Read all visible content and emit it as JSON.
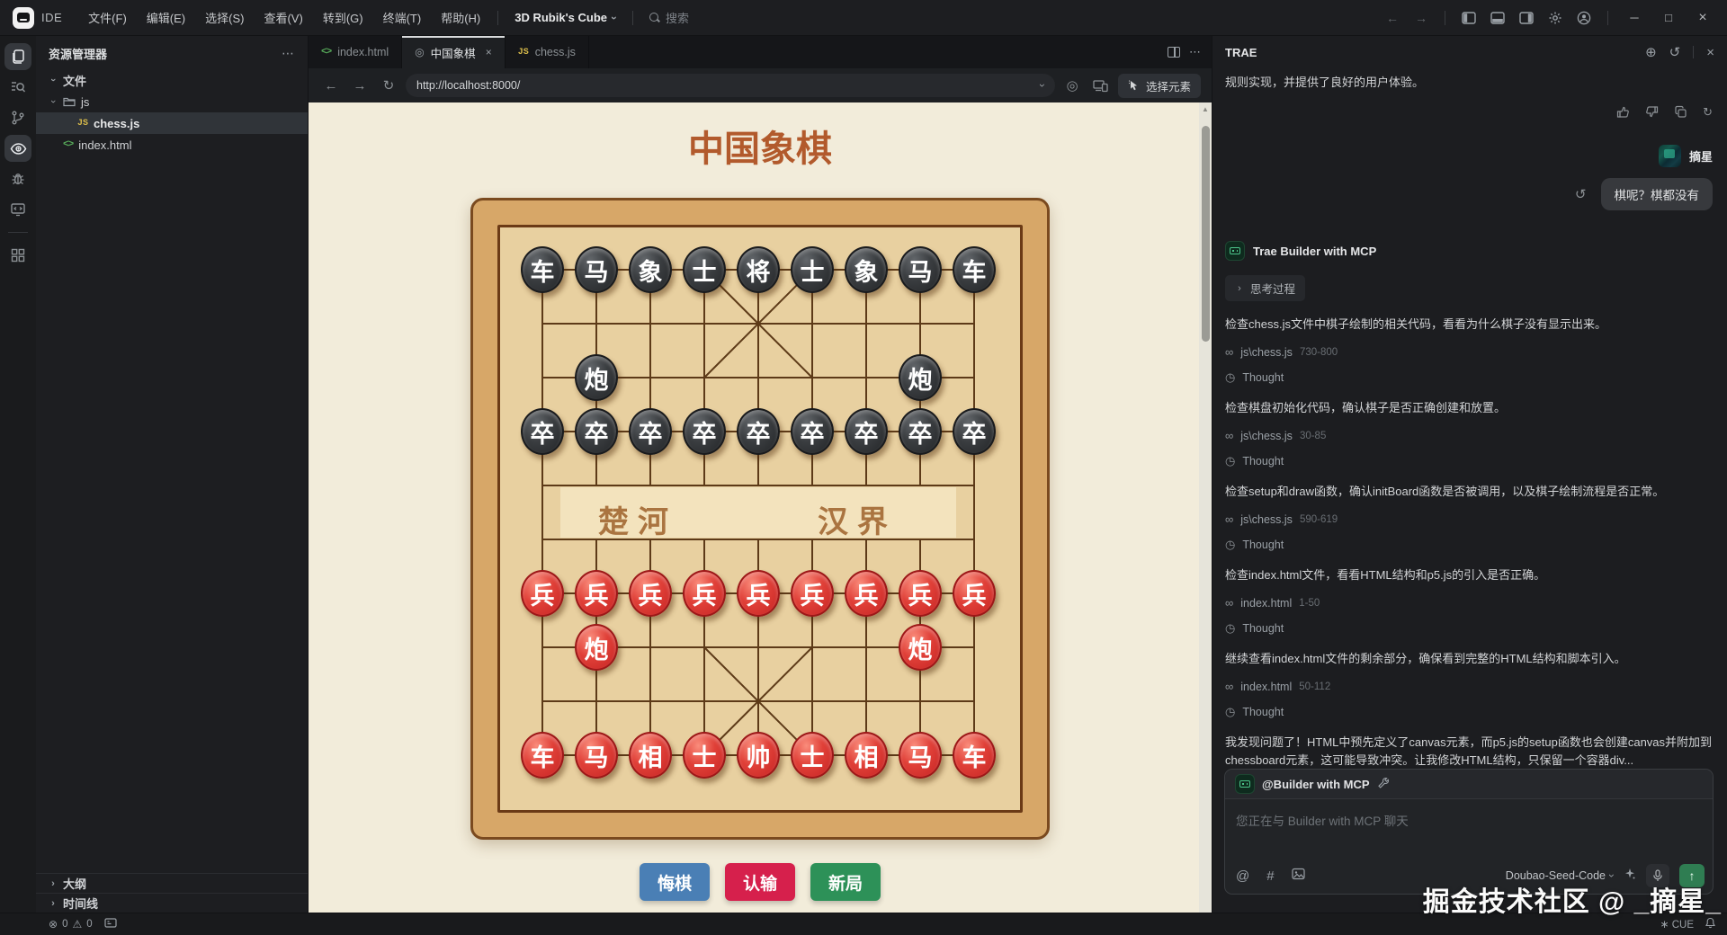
{
  "titlebar": {
    "logo": "IDE",
    "menus": [
      "文件(F)",
      "编辑(E)",
      "选择(S)",
      "查看(V)",
      "转到(G)",
      "终端(T)",
      "帮助(H)"
    ],
    "project": "3D Rubik's Cube",
    "search_placeholder": "搜索"
  },
  "explorer": {
    "title": "资源管理器",
    "more": "⋯",
    "root_label": "文件",
    "folder_label": "js",
    "file_js": "chess.js",
    "file_html": "index.html",
    "outline_label": "大纲",
    "timeline_label": "时间线"
  },
  "tabs": [
    {
      "label": "index.html",
      "icon": "html",
      "active": false,
      "closable": false
    },
    {
      "label": "中国象棋",
      "icon": "preview",
      "active": true,
      "closable": true
    },
    {
      "label": "chess.js",
      "icon": "js",
      "active": false,
      "closable": false
    }
  ],
  "browser": {
    "url": "http://localhost:8000/",
    "select_element_label": "选择元素"
  },
  "preview": {
    "page_title": "中国象棋",
    "page_bg": "#f2ecda",
    "title_color": "#b25a2c",
    "river_left": "楚河",
    "river_right": "汉界",
    "buttons": [
      {
        "label": "悔棋",
        "color": "#4a7fb5"
      },
      {
        "label": "认输",
        "color": "#d6204c"
      },
      {
        "label": "新局",
        "color": "#2d9158"
      }
    ],
    "board": {
      "cols": 9,
      "rows": 10,
      "cell": 60,
      "frame_color": "#d7a768",
      "field_color": "#e8d0a0",
      "line_color": "#5d3a18",
      "black_piece_color": "#2b2d30",
      "red_piece_color": "#d42c2c",
      "layout": [
        {
          "row": 0,
          "side": "black",
          "cols": [
            0,
            1,
            2,
            3,
            4,
            5,
            6,
            7,
            8
          ],
          "chars": [
            "车",
            "马",
            "象",
            "士",
            "将",
            "士",
            "象",
            "马",
            "车"
          ]
        },
        {
          "row": 2,
          "side": "black",
          "cols": [
            1,
            7
          ],
          "chars": [
            "炮",
            "炮"
          ]
        },
        {
          "row": 3,
          "side": "black",
          "cols": [
            0,
            1,
            2,
            3,
            4,
            5,
            6,
            7,
            8
          ],
          "chars": [
            "卒",
            "卒",
            "卒",
            "卒",
            "卒",
            "卒",
            "卒",
            "卒",
            "卒"
          ]
        },
        {
          "row": 6,
          "side": "red",
          "cols": [
            0,
            1,
            2,
            3,
            4,
            5,
            6,
            7,
            8
          ],
          "chars": [
            "兵",
            "兵",
            "兵",
            "兵",
            "兵",
            "兵",
            "兵",
            "兵",
            "兵"
          ]
        },
        {
          "row": 7,
          "side": "red",
          "cols": [
            1,
            7
          ],
          "chars": [
            "炮",
            "炮"
          ]
        },
        {
          "row": 9,
          "side": "red",
          "cols": [
            0,
            1,
            2,
            3,
            4,
            5,
            6,
            7,
            8
          ],
          "chars": [
            "车",
            "马",
            "相",
            "士",
            "帅",
            "士",
            "相",
            "马",
            "车"
          ]
        }
      ]
    }
  },
  "chat": {
    "title": "TRAE",
    "previous_tail": "规则实现，并提供了良好的用户体验。",
    "user_name": "摘星",
    "user_message": "棋呢？棋都没有",
    "assistant_name": "Trae Builder with MCP",
    "thinking_label": "思考过程",
    "items": [
      {
        "type": "text",
        "text": "检查chess.js文件中棋子绘制的相关代码，看看为什么棋子没有显示出来。"
      },
      {
        "type": "ref",
        "file": "js\\chess.js",
        "range": "730-800"
      },
      {
        "type": "thought",
        "label": "Thought"
      },
      {
        "type": "text",
        "text": "检查棋盘初始化代码，确认棋子是否正确创建和放置。"
      },
      {
        "type": "ref",
        "file": "js\\chess.js",
        "range": "30-85"
      },
      {
        "type": "thought",
        "label": "Thought"
      },
      {
        "type": "text",
        "text": "检查setup和draw函数，确认initBoard函数是否被调用，以及棋子绘制流程是否正常。"
      },
      {
        "type": "ref",
        "file": "js\\chess.js",
        "range": "590-619"
      },
      {
        "type": "thought",
        "label": "Thought"
      },
      {
        "type": "text",
        "text": "检查index.html文件，看看HTML结构和p5.js的引入是否正确。"
      },
      {
        "type": "ref",
        "file": "index.html",
        "range": "1-50"
      },
      {
        "type": "thought",
        "label": "Thought"
      },
      {
        "type": "text",
        "text": "继续查看index.html文件的剩余部分，确保看到完整的HTML结构和脚本引入。"
      },
      {
        "type": "ref",
        "file": "index.html",
        "range": "50-112"
      },
      {
        "type": "thought",
        "label": "Thought"
      },
      {
        "type": "text",
        "text": "我发现问题了！HTML中预先定义了canvas元素，而p5.js的setup函数也会创建canvas并附加到chessboard元素，这可能导致冲突。让我修改HTML结构，只保留一个容器div..."
      }
    ],
    "input": {
      "agent": "@Builder with MCP",
      "placeholder": "您正在与 Builder with MCP 聊天",
      "model": "Doubao-Seed-Code"
    },
    "watermark": "掘金技术社区 @ _摘星_"
  },
  "statusbar": {
    "errors": "0",
    "warnings": "0",
    "cue_label": "CUE"
  },
  "icons": {
    "back": "←",
    "forward": "→",
    "refresh": "↻",
    "plus_circle": "⊕",
    "history": "↺",
    "close": "×",
    "minimize": "─",
    "maximize": "□",
    "ellipsis": "⋯",
    "chevron": "›",
    "up_arrow": "↑",
    "at": "@",
    "hash": "#",
    "target": "◎",
    "error_circle": "⊗",
    "warning_triangle": "⚠",
    "scroll_up": "▲",
    "cue_spark": "∗",
    "link_infinity": "∞",
    "thought_clock": "◷",
    "retry": "↺"
  }
}
